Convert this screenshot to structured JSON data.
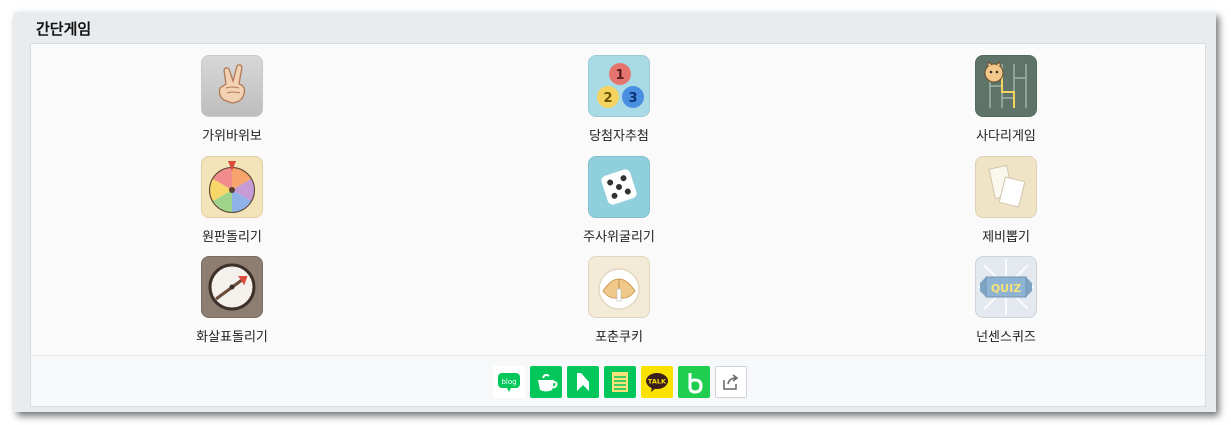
{
  "section": {
    "title": "간단게임"
  },
  "games": [
    {
      "label": "가위바위보",
      "icon": "rock-paper-scissors-icon"
    },
    {
      "label": "당첨자추첨",
      "icon": "lottery-balls-icon"
    },
    {
      "label": "사다리게임",
      "icon": "ladder-game-icon"
    },
    {
      "label": "원판돌리기",
      "icon": "roulette-wheel-icon"
    },
    {
      "label": "주사위굴리기",
      "icon": "dice-icon"
    },
    {
      "label": "제비뽑기",
      "icon": "paper-slips-icon"
    },
    {
      "label": "화살표돌리기",
      "icon": "spinning-arrow-icon"
    },
    {
      "label": "포춘쿠키",
      "icon": "fortune-cookie-icon"
    },
    {
      "label": "넌센스퀴즈",
      "icon": "quiz-icon"
    }
  ],
  "lottery_numbers": [
    "1",
    "2",
    "3"
  ],
  "quiz_badge": "QUIZ",
  "share": {
    "blog": "blog",
    "talk": "TALK",
    "items": [
      "blog-share-icon",
      "cafe-share-icon",
      "keep-share-icon",
      "memo-share-icon",
      "kakaotalk-share-icon",
      "band-share-icon",
      "share-external-icon"
    ]
  },
  "colors": {
    "frame_bg": "#e9ecef",
    "naver_green": "#03c75a",
    "kakao_yellow": "#fae100"
  }
}
